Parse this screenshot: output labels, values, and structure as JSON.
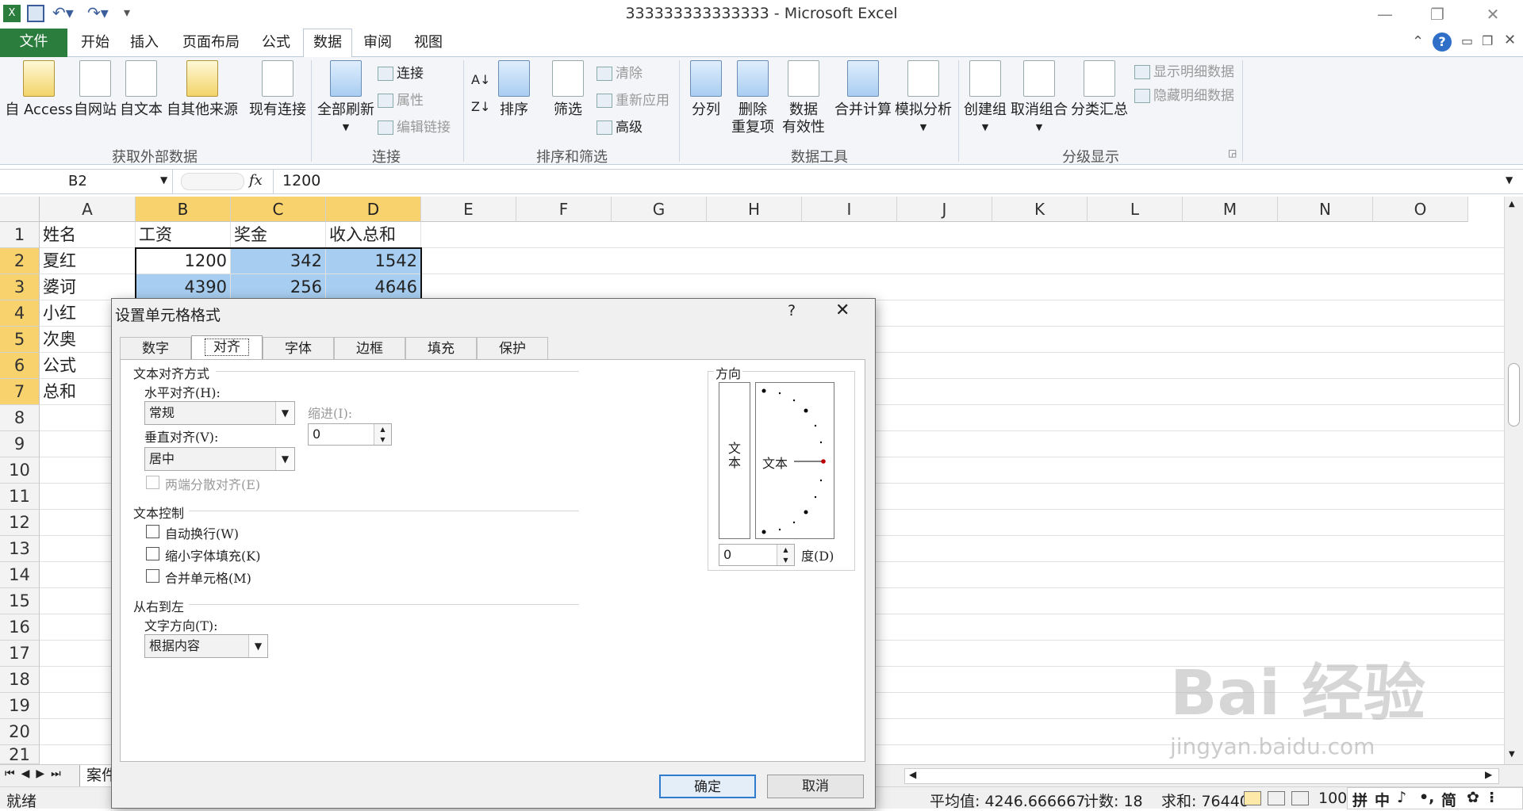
{
  "window": {
    "title": "333333333333333 - Microsoft Excel"
  },
  "tabs": {
    "file": "文件",
    "items": [
      "开始",
      "插入",
      "页面布局",
      "公式",
      "数据",
      "审阅",
      "视图"
    ],
    "active": "数据"
  },
  "ribbon": {
    "ext": {
      "btn1": "自 Access",
      "btn2": "自网站",
      "btn3": "自文本",
      "btn4": "自其他来源",
      "btn5": "现有连接",
      "label": "获取外部数据"
    },
    "conn": {
      "refresh": "全部刷新",
      "connect": "连接",
      "props": "属性",
      "edit_links": "编辑链接",
      "label": "连接"
    },
    "sort": {
      "sort": "排序",
      "filter": "筛选",
      "clear": "清除",
      "reapply": "重新应用",
      "advanced": "高级",
      "label": "排序和筛选"
    },
    "tools": {
      "split": "分列",
      "remove1": "删除",
      "remove2": "重复项",
      "valid1": "数据",
      "valid2": "有效性",
      "consolidate": "合并计算",
      "whatif": "模拟分析",
      "label": "数据工具"
    },
    "outline": {
      "group": "创建组",
      "ungroup": "取消组合",
      "subtotal": "分类汇总",
      "show": "显示明细数据",
      "hide": "隐藏明细数据",
      "label": "分级显示"
    }
  },
  "formula_bar": {
    "name_box": "B2",
    "fx": "fx",
    "value": "1200"
  },
  "columns": [
    "A",
    "B",
    "C",
    "D",
    "E",
    "F",
    "G",
    "H",
    "I",
    "J",
    "K",
    "L",
    "M",
    "N",
    "O"
  ],
  "rows": [
    "1",
    "2",
    "3",
    "4",
    "5",
    "6",
    "7",
    "8",
    "9",
    "10",
    "11",
    "12",
    "13",
    "14",
    "15",
    "16",
    "17",
    "18",
    "19",
    "20",
    "21"
  ],
  "cells": {
    "a1": "姓名",
    "b1": "工资",
    "c1": "奖金",
    "d1": "收入总和",
    "a2": "夏红",
    "b2": "1200",
    "c2": "342",
    "d2": "1542",
    "a3": "婆诃",
    "b3": "4390",
    "c3": "256",
    "d3": "4646",
    "a4": "小红",
    "a5": "次奥",
    "a6": "公式",
    "a7": "总和"
  },
  "sheet_tab": "案件",
  "status": {
    "ready": "就绪",
    "average": "平均值: 4246.666667",
    "count": "计数: 18",
    "sum": "求和: 76440",
    "zoom": "100"
  },
  "ime": {
    "mode1": "拼",
    "mode2": "中",
    "mode3": "简"
  },
  "dialog": {
    "title": "设置单元格格式",
    "help": "?",
    "close": "✕",
    "tabs": [
      "数字",
      "对齐",
      "字体",
      "边框",
      "填充",
      "保护"
    ],
    "active_tab": "对齐",
    "text_align_section": "文本对齐方式",
    "horizontal_label": "水平对齐(H):",
    "horizontal_value": "常规",
    "indent_label": "缩进(I):",
    "indent_value": "0",
    "vertical_label": "垂直对齐(V):",
    "vertical_value": "居中",
    "justify_distributed": "两端分散对齐(E)",
    "text_control_section": "文本控制",
    "wrap_text": "自动换行(W)",
    "shrink_to_fit": "缩小字体填充(K)",
    "merge_cells": "合并单元格(M)",
    "rtl_section": "从右到左",
    "text_direction_label": "文字方向(T):",
    "text_direction_value": "根据内容",
    "orientation_section": "方向",
    "vertical_text": "文本",
    "orientation_text": "文本",
    "degrees_value": "0",
    "degrees_label": "度(D)",
    "ok": "确定",
    "cancel": "取消"
  },
  "watermark": {
    "main": "Bai 经验",
    "sub": "jingyan.baidu.com"
  }
}
